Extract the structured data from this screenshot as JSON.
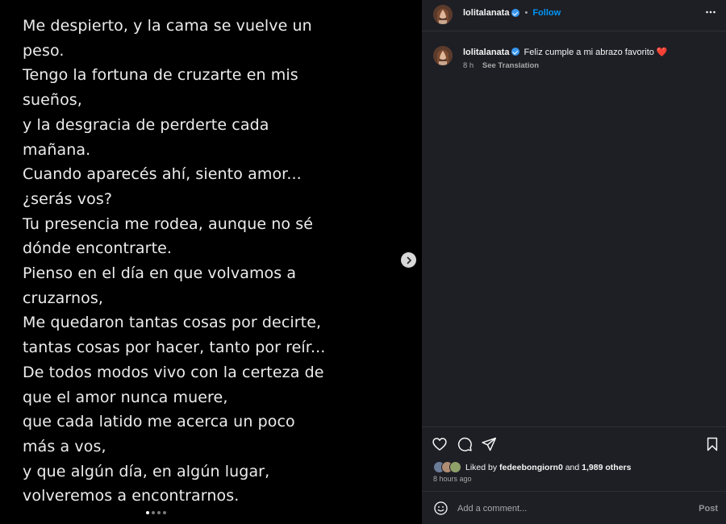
{
  "post": {
    "poem_lines": [
      "Me despierto, y la cama se vuelve un",
      "peso.",
      "Tengo la fortuna de cruzarte en mis",
      "sueños,",
      "y la desgracia de perderte cada",
      "mañana.",
      "Cuando aparecés ahí, siento amor...",
      "¿serás vos?",
      "Tu presencia me rodea, aunque no sé",
      "dónde encontrarte.",
      "Pienso en el día en que volvamos a",
      "cruzarnos,",
      "Me quedaron tantas cosas por decirte,",
      "tantas cosas por hacer, tanto por reír...",
      "De todos modos vivo con la certeza de",
      "que el amor nunca muere,",
      "que cada latido me acerca un poco",
      "más a vos,",
      "y que algún día, en algún lugar,",
      "volveremos a encontrarnos."
    ],
    "carousel": {
      "count": 4,
      "active_index": 0
    }
  },
  "header": {
    "username": "lolitalanata",
    "separator": "•",
    "follow_label": "Follow",
    "more_icon": "more-horizontal-icon"
  },
  "caption": {
    "username": "lolitalanata",
    "text": "Feliz cumple a mi abrazo favorito ❤️",
    "time": "8 h",
    "translation_label": "See Translation"
  },
  "actions": {
    "icons": [
      "heart-icon",
      "comment-icon",
      "share-icon",
      "bookmark-icon"
    ]
  },
  "likes": {
    "prefix": "Liked by",
    "user": "fedeebongiorn0",
    "connector": "and",
    "others": "1,989 others",
    "time_ago": "8 hours ago"
  },
  "comment_box": {
    "placeholder": "Add a comment...",
    "post_label": "Post"
  },
  "colors": {
    "panel_bg": "#1e1f25",
    "accent": "#0095f6",
    "verified": "#3897f0",
    "heart": "#ed4956"
  }
}
